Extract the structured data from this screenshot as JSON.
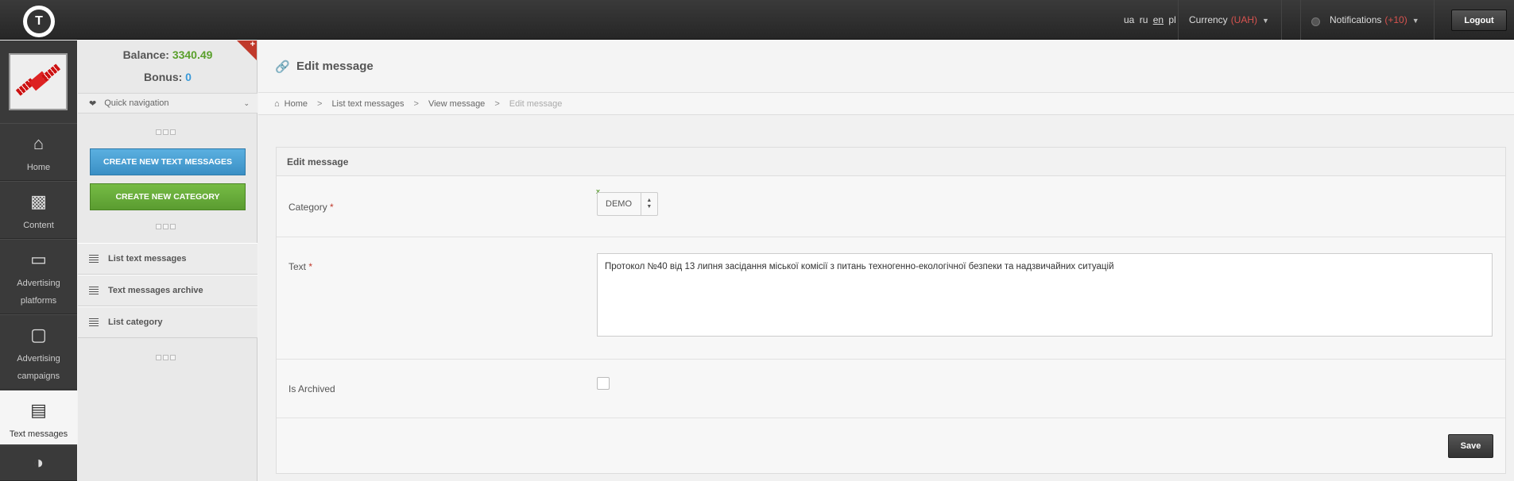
{
  "topbar": {
    "logo_letter": "T",
    "languages": [
      "ua",
      "ru",
      "en",
      "pl"
    ],
    "active_language": "en",
    "currency_label": "Currency",
    "currency_value": "(UAH)",
    "notifications_label": "Notifications",
    "notifications_count": "(+10)",
    "logout_label": "Logout"
  },
  "iconbar": {
    "items": [
      {
        "label": "Home",
        "icon": "home-icon"
      },
      {
        "label": "Content",
        "icon": "video-camera-icon"
      },
      {
        "label": "Advertising platforms",
        "icon": "monitor-icon"
      },
      {
        "label": "Advertising campaigns",
        "icon": "folder-icon"
      },
      {
        "label": "Text messages",
        "icon": "text-messages-icon"
      }
    ]
  },
  "sidebar": {
    "balance_label": "Balance:",
    "balance_value": "3340.49",
    "bonus_label": "Bonus:",
    "bonus_value": "0",
    "quick_nav_label": "Quick navigation",
    "create_text_label": "CREATE NEW TEXT MESSAGES",
    "create_category_label": "CREATE NEW CATEGORY",
    "links": [
      "List text messages",
      "Text messages archive",
      "List category"
    ]
  },
  "main": {
    "page_title": "Edit message",
    "breadcrumbs": [
      "Home",
      "List text messages",
      "View message",
      "Edit message"
    ],
    "panel_title": "Edit message",
    "fields": {
      "category_label": "Category",
      "category_value": "DEMO",
      "category_clear": "x",
      "text_label": "Text",
      "text_value": "Протокол №40 від 13 липня засідання міської комісії з питань техногенно-екологічної безпеки та надзвичайних ситуацій",
      "archived_label": "Is Archived",
      "required_mark": "*"
    },
    "save_label": "Save"
  },
  "colors": {
    "balance": "#5aa02c",
    "bonus": "#3a9ad9",
    "currency": "#d9534f",
    "blue_button": "#3a8fc5",
    "green_button": "#5a9c30"
  }
}
